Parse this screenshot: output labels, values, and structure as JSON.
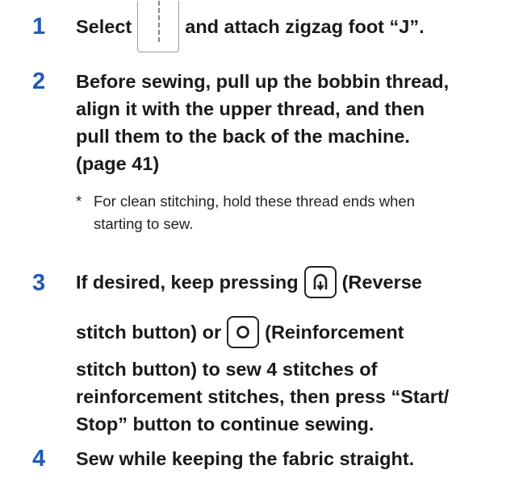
{
  "steps": [
    {
      "number": "1",
      "before_icon": "Select",
      "icon": "straight-stitch-icon",
      "after_icon": "and attach zigzag foot “J”."
    },
    {
      "number": "2",
      "lines": [
        "Before sewing, pull up the bobbin thread,",
        "align it with the upper thread, and then",
        "pull them to the back of the machine.",
        "(page 41)"
      ],
      "note_marker": "*",
      "note_lines": [
        "For clean stitching, hold these thread ends when",
        "starting to sew."
      ]
    },
    {
      "number": "3",
      "line1_before": "If desired, keep pressing",
      "icon1": "reverse-stitch-icon",
      "line1_after": "(Reverse",
      "line2_before": "stitch button) or",
      "icon2": "reinforcement-stitch-icon",
      "line2_after": "(Reinforcement",
      "lines": [
        "stitch button) to sew 4 stitches of",
        "reinforcement stitches, then press “Start/",
        "Stop” button to continue sewing."
      ]
    },
    {
      "number": "4",
      "lines": [
        "Sew while keeping the fabric straight."
      ]
    }
  ],
  "colors": {
    "step_number": "#1e5bb5",
    "text": "#1a1a1a"
  }
}
